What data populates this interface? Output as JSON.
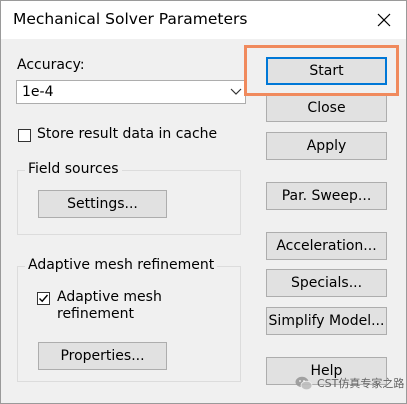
{
  "window": {
    "title": "Mechanical Solver Parameters",
    "close_icon": "close-icon"
  },
  "accuracy": {
    "label": "Accuracy:",
    "value": "1e-4",
    "icon": "chevron-down-icon"
  },
  "store_cache": {
    "label": "Store result data in cache",
    "checked": false
  },
  "field_sources": {
    "title": "Field sources",
    "settings_button": "Settings..."
  },
  "adaptive": {
    "title": "Adaptive mesh refinement",
    "checkbox_line1": "Adaptive mesh",
    "checkbox_line2": "refinement",
    "checked": true,
    "properties_button": "Properties..."
  },
  "buttons": {
    "start": "Start",
    "close": "Close",
    "apply": "Apply",
    "par_sweep": "Par. Sweep...",
    "acceleration": "Acceleration...",
    "specials": "Specials...",
    "simplify_model": "Simplify Model...",
    "help": "Help"
  },
  "highlight_color": "#f08a5d",
  "watermark": {
    "text": "CST仿真专家之路",
    "icon": "wechat-icon"
  }
}
